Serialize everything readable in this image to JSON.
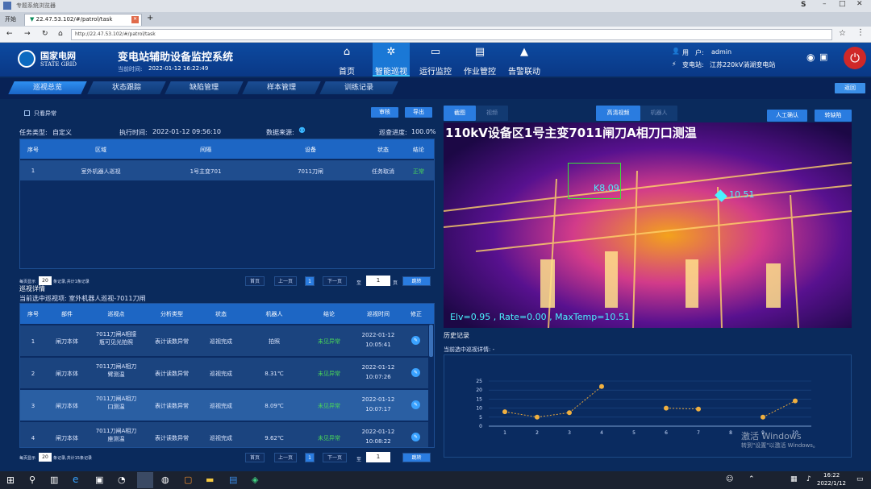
{
  "browser": {
    "window_title": "专题系统浏览器",
    "tab_first": "开始",
    "tab_url": "22.47.53.102/#/patrol/task",
    "address": "http://22.47.53.102/#/patrol/task",
    "user_initial": "S"
  },
  "header": {
    "logo_cn": "国家电网",
    "logo_en": "STATE GRID",
    "title": "变电站辅助设备监控系统",
    "time_label": "当前时间:",
    "time": "2022-01-12 16:22:49",
    "nav": [
      {
        "label": "首页",
        "icon": "⌂"
      },
      {
        "label": "智能巡视",
        "icon": "✲"
      },
      {
        "label": "运行监控",
        "icon": "▭"
      },
      {
        "label": "作业管控",
        "icon": "▤"
      },
      {
        "label": "告警联动",
        "icon": "▲"
      }
    ],
    "user_label": "用　户:",
    "user": "admin",
    "station_label": "变电站:",
    "station": "江苏220kV淌湖变电站"
  },
  "subnav": {
    "tabs": [
      "巡视总览",
      "状态跟踪",
      "缺陷管理",
      "样本管理",
      "训练记录"
    ],
    "back": "返回"
  },
  "task": {
    "only_abnormal": "只看异常",
    "btn_review": "审核",
    "btn_export": "导出",
    "type_label": "任务类型:",
    "type": "自定义",
    "exec_label": "执行时间:",
    "exec_time": "2022-01-12 09:56:10",
    "source_label": "数据来源:",
    "progress_label": "巡查进度:",
    "progress": "100.0%",
    "headers": [
      "序号",
      "区域",
      "间隔",
      "设备",
      "状态",
      "结论"
    ],
    "rows": [
      [
        "1",
        "室外机器人巡视",
        "1号主变701",
        "7011刀闸",
        "任务取消",
        "正常"
      ]
    ]
  },
  "pager1": {
    "per_page_label": "每页显示",
    "per_page": "20",
    "total": "条记录,共计1条记录",
    "first": "首页",
    "prev": "上一页",
    "page": "1",
    "next": "下一页",
    "goto_label": "至",
    "goto_page": "1",
    "go_unit": "页",
    "jump": "跳转"
  },
  "detail": {
    "title": "巡视详情",
    "current": "当前选中巡视项: 室外机器人巡视-7011刀闸",
    "headers": [
      "序号",
      "部件",
      "巡视点",
      "分析类型",
      "状态",
      "机器人",
      "结论",
      "巡视时间",
      "修正"
    ],
    "rows": [
      {
        "no": "1",
        "part": "闸刀本体",
        "point": "7011刀闸A相接\n瓶可见光拍照",
        "type": "表计读数异常",
        "status": "巡视完成",
        "robot": "拍照",
        "result": "未见异常",
        "date": "2022-01-12",
        "time": "10:05:41"
      },
      {
        "no": "2",
        "part": "闸刀本体",
        "point": "7011刀闸A相刀\n臂测温",
        "type": "表计读数异常",
        "status": "巡视完成",
        "robot": "8.31℃",
        "result": "未见异常",
        "date": "2022-01-12",
        "time": "10:07:26"
      },
      {
        "no": "3",
        "part": "闸刀本体",
        "point": "7011刀闸A相刀\n口测温",
        "type": "表计读数异常",
        "status": "巡视完成",
        "robot": "8.09℃",
        "result": "未见异常",
        "date": "2022-01-12",
        "time": "10:07:17"
      },
      {
        "no": "4",
        "part": "闸刀本体",
        "point": "7011刀闸A相刀\n座测温",
        "type": "表计读数异常",
        "status": "巡视完成",
        "robot": "9.62℃",
        "result": "未见异常",
        "date": "2022-01-12",
        "time": "10:08:22"
      }
    ]
  },
  "pager2": {
    "per_page_label": "每页显示",
    "per_page": "20",
    "total": "条记录,共计15条记录",
    "first": "首页",
    "prev": "上一页",
    "page": "1",
    "next": "下一页",
    "goto_label": "至",
    "goto_page": "1",
    "jump": "跳转"
  },
  "view": {
    "tab_image": "截图",
    "tab_video": "视频",
    "tab_hd": "高清视频",
    "tab_robot": "机器人",
    "btn_manual": "人工确认",
    "btn_defect": "转缺陷",
    "caption": "110kV设备区1号主变7011闸刀A相刀口测温",
    "box_value": "K8.09",
    "point_value": "10.51",
    "footer": "Elv=0.95 , Rate=0.00 , MaxTemp=10.51"
  },
  "history": {
    "title": "历史记录",
    "current": "当前选中巡视详情: -"
  },
  "chart_data": {
    "type": "line",
    "x": [
      1,
      2,
      3,
      4,
      5,
      6,
      7,
      8,
      9,
      10
    ],
    "x_ticks": [
      "1",
      "2",
      "3",
      "4",
      "5",
      "6",
      "7",
      "8",
      "9",
      "10"
    ],
    "y_ticks": [
      "0",
      "5",
      "10",
      "15",
      "20",
      "25"
    ],
    "ylim": [
      0,
      25
    ],
    "series": [
      {
        "values": [
          8,
          5,
          7.5,
          22,
          null,
          10,
          9.5,
          null,
          5,
          14
        ]
      }
    ]
  },
  "watermark": {
    "line1": "激活 Windows",
    "line2": "转到\"设置\"以激活 Windows。"
  },
  "taskbar": {
    "time": "16:22",
    "date": "2022/1/12"
  }
}
